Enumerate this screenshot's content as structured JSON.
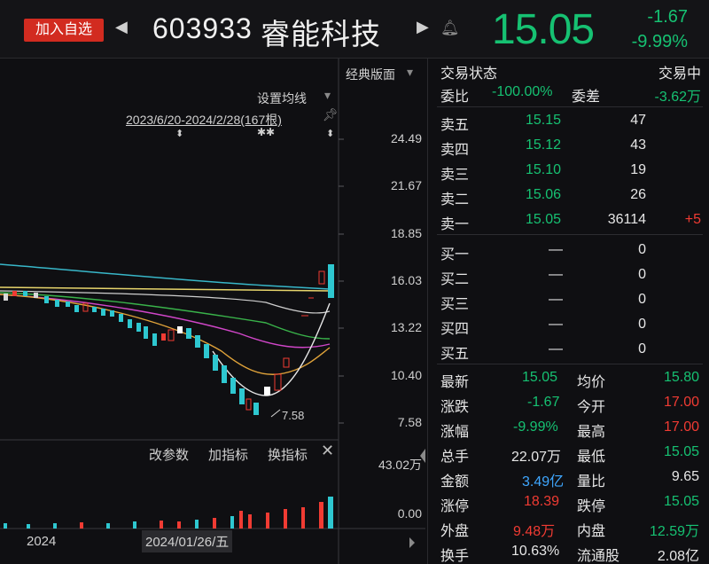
{
  "header": {
    "add_button": "加入自选",
    "nav_prev": "◀",
    "nav_next": "▶",
    "code": "603933",
    "name": "睿能科技",
    "price": "15.05",
    "change": "-1.67",
    "change_pct": "-9.99%"
  },
  "chart": {
    "mode_label": "经典版面",
    "ma_setting": "设置均线",
    "range_label": "2023/6/20-2024/2/28(167根)",
    "min_label": "7.58",
    "y_ticks": [
      "24.49",
      "21.67",
      "18.85",
      "16.03",
      "13.22",
      "10.40",
      "7.58"
    ],
    "vol_ticks": [
      "43.02万",
      "0.00"
    ],
    "indicator_tabs": [
      "改参数",
      "加指标",
      "换指标"
    ],
    "x_year": "2024",
    "x_cursor_date": "2024/01/26/五"
  },
  "chart_data": {
    "type": "candlestick",
    "y_range": [
      7.58,
      24.49
    ],
    "last_price": 15.05,
    "min_price": 7.58
  },
  "panel": {
    "status_label": "交易状态",
    "status_value": "交易中",
    "weibi_label": "委比",
    "weibi_value": "-100.00%",
    "weicha_label": "委差",
    "weicha_value": "-3.62万",
    "asks": [
      {
        "label": "卖五",
        "price": "15.15",
        "vol": "47",
        "delta": ""
      },
      {
        "label": "卖四",
        "price": "15.12",
        "vol": "43",
        "delta": ""
      },
      {
        "label": "卖三",
        "price": "15.10",
        "vol": "19",
        "delta": ""
      },
      {
        "label": "卖二",
        "price": "15.06",
        "vol": "26",
        "delta": ""
      },
      {
        "label": "卖一",
        "price": "15.05",
        "vol": "36114",
        "delta": "+5"
      }
    ],
    "bids": [
      {
        "label": "买一",
        "price": "—",
        "vol": "0"
      },
      {
        "label": "买二",
        "price": "—",
        "vol": "0"
      },
      {
        "label": "买三",
        "price": "—",
        "vol": "0"
      },
      {
        "label": "买四",
        "price": "—",
        "vol": "0"
      },
      {
        "label": "买五",
        "price": "—",
        "vol": "0"
      }
    ],
    "stats": [
      {
        "l1": "最新",
        "v1": "15.05",
        "l2": "均价",
        "v2": "15.80"
      },
      {
        "l1": "涨跌",
        "v1": "-1.67",
        "l2": "今开",
        "v2": "17.00"
      },
      {
        "l1": "涨幅",
        "v1": "-9.99%",
        "l2": "最高",
        "v2": "17.00"
      },
      {
        "l1": "总手",
        "v1": "22.07万",
        "l2": "最低",
        "v2": "15.05"
      },
      {
        "l1": "金额",
        "v1": "3.49亿",
        "l2": "量比",
        "v2": "9.65"
      },
      {
        "l1": "涨停",
        "v1": "18.39",
        "l2": "跌停",
        "v2": "15.05"
      },
      {
        "l1": "外盘",
        "v1": "9.48万",
        "l2": "内盘",
        "v2": "12.59万"
      },
      {
        "l1": "换手",
        "v1": "10.63%",
        "l2": "流通股",
        "v2": "2.08亿"
      }
    ]
  }
}
